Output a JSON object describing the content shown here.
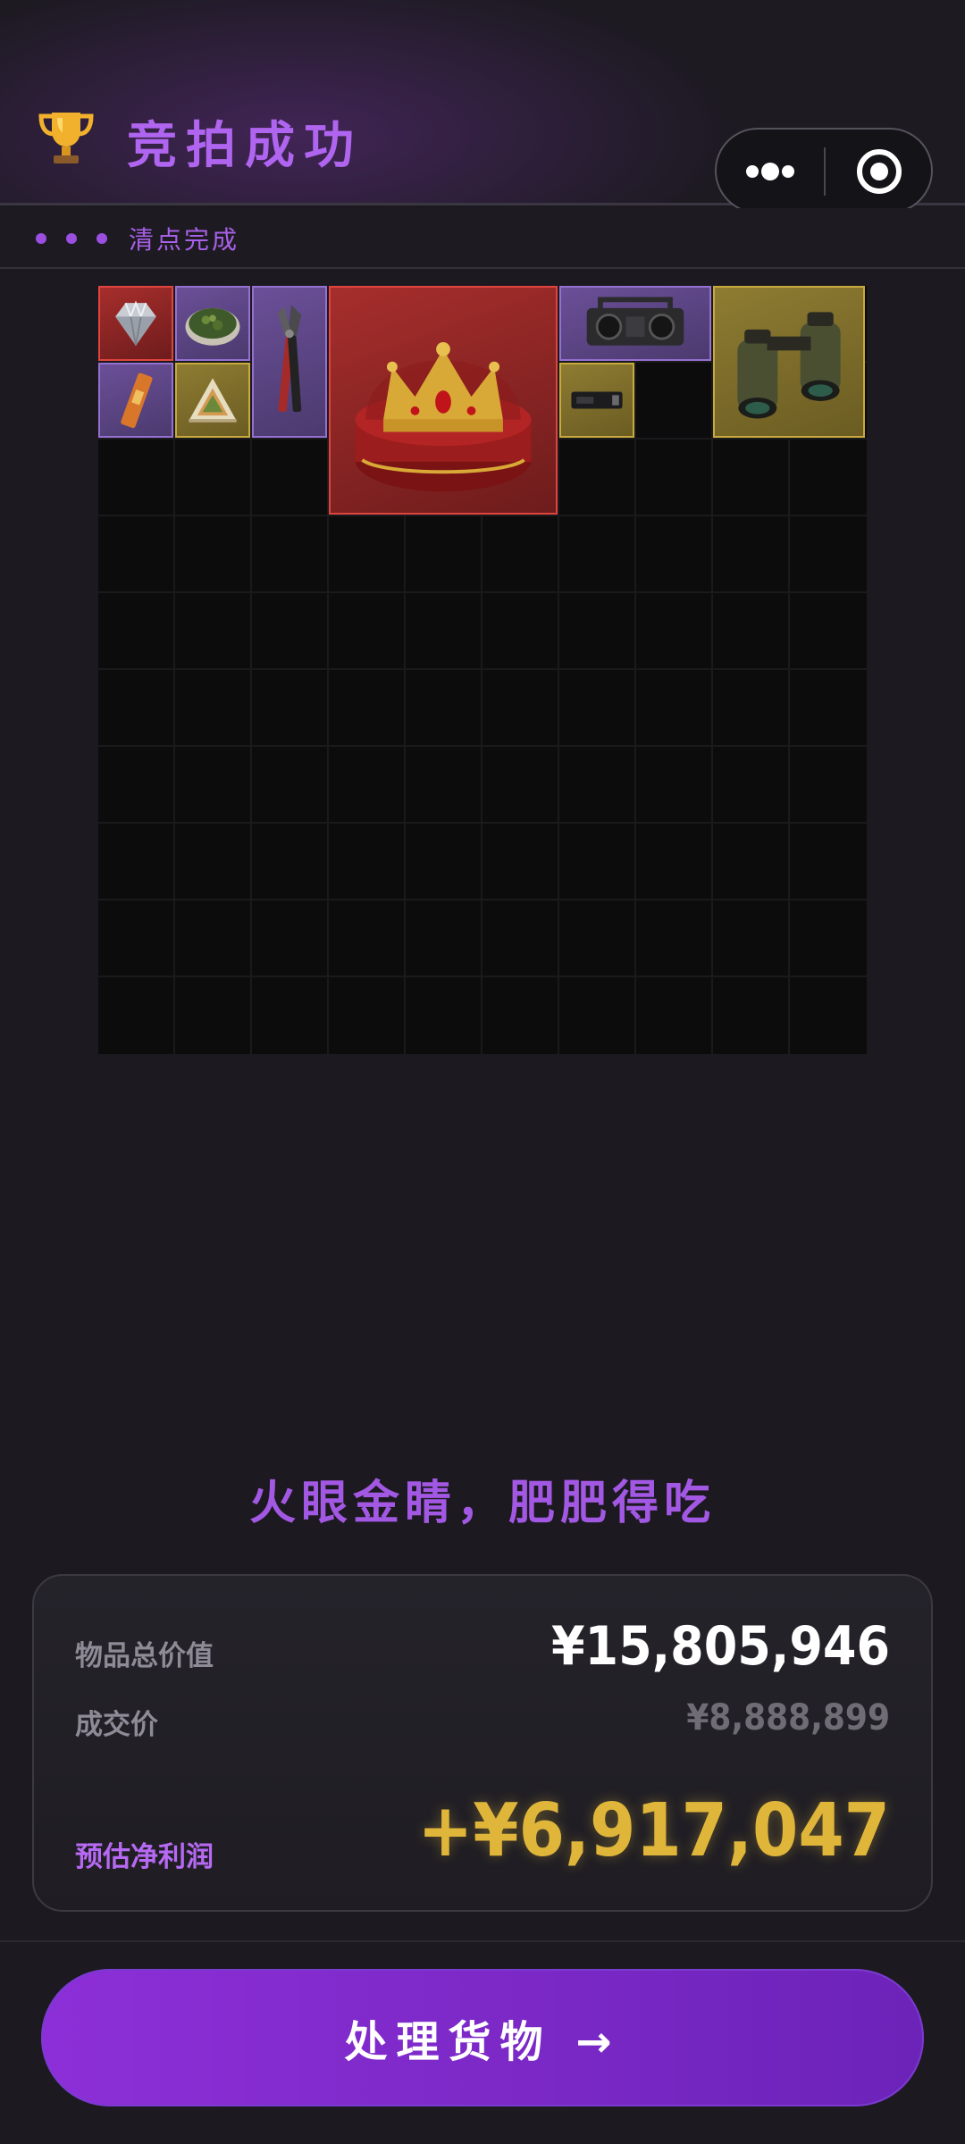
{
  "header": {
    "title": "竞拍成功",
    "trophy_icon": "trophy-icon",
    "menu_icon": "more-dots-icon",
    "target_icon": "target-icon"
  },
  "status": {
    "text": "清点完成"
  },
  "inventory": {
    "columns": 10,
    "rows": 10,
    "items": [
      {
        "name": "diamond",
        "rarity": "red"
      },
      {
        "name": "herb-dish",
        "rarity": "purple"
      },
      {
        "name": "bolt-cutter",
        "rarity": "purple"
      },
      {
        "name": "royal-crown-box",
        "rarity": "red"
      },
      {
        "name": "boombox",
        "rarity": "purple"
      },
      {
        "name": "binoculars",
        "rarity": "gold"
      },
      {
        "name": "energy-bar",
        "rarity": "purple"
      },
      {
        "name": "sandwich",
        "rarity": "gold"
      },
      {
        "name": "ssd-drive",
        "rarity": "gold"
      }
    ]
  },
  "slogan": "火眼金睛，肥肥得吃",
  "summary": {
    "total_label": "物品总价值",
    "total_value": "¥15,805,946",
    "deal_label": "成交价",
    "deal_value": "¥8,888,899",
    "profit_label": "预估净利润",
    "profit_value": "+¥6,917,047"
  },
  "cta": {
    "label": "处理货物 →"
  },
  "colors": {
    "accent_purple": "#a358e4",
    "profit_gold": "#e0b63a",
    "rarity_purple": "#6b4f98",
    "rarity_gold": "#8e7c32",
    "rarity_red": "#a62e2c"
  }
}
